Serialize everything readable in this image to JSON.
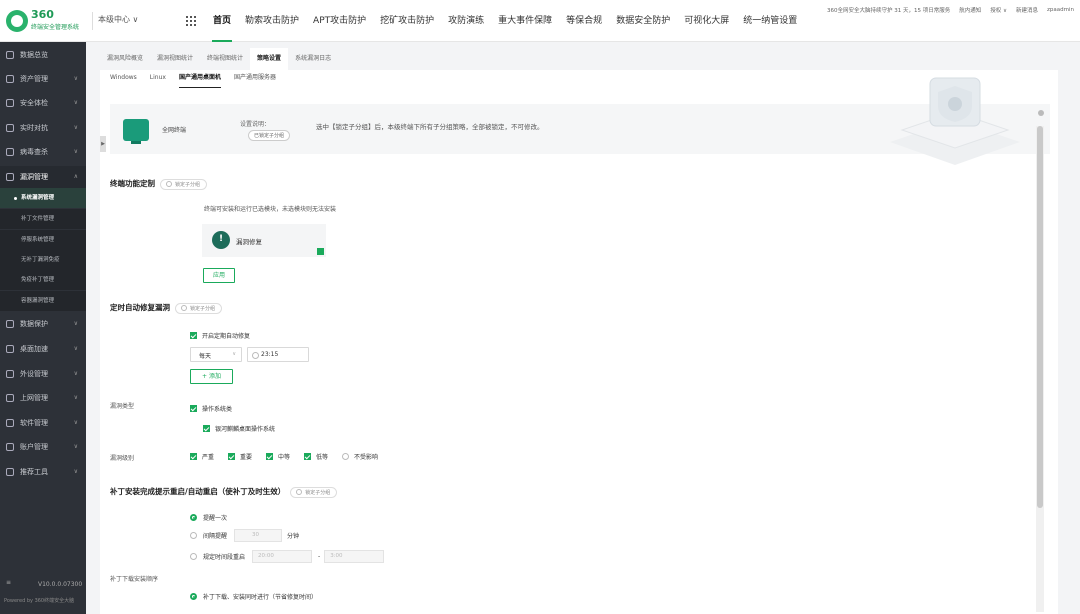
{
  "app": {
    "logo_text": "360",
    "logo_sub": "终端安全管理系统",
    "unit_selector": "本级中心 ∨"
  },
  "nav": {
    "items": [
      "首页",
      "勒索攻击防护",
      "APT攻击防护",
      "挖矿攻击防护",
      "攻防演练",
      "重大事件保障",
      "等保合规",
      "数据安全防护",
      "可视化大屏",
      "统一纳管设置"
    ],
    "active_index": 0
  },
  "top_right": {
    "protect_text": "360全网安全大脑持续守护 31 天，15 项日常服务",
    "links": [
      "航内通知",
      "授权 ∨",
      "新建消息"
    ],
    "user": "zpaadmin"
  },
  "sidebar": {
    "items": [
      "数据总览",
      "资产管理",
      "安全体检",
      "实时对抗",
      "病毒查杀",
      "漏洞管理",
      "数据保护",
      "桌面加速",
      "外设管理",
      "上网管理",
      "软件管理",
      "账户管理",
      "推荐工具"
    ],
    "sub_items": [
      "系统漏洞管理",
      "补丁文件管理",
      "停服系统管理",
      "无补丁漏洞免疫",
      "免疫补丁管理",
      "容器漏洞管理"
    ],
    "active_sub": 0,
    "version": "V10.0.0.07300",
    "powered": "Powered by 360终端安全大脑"
  },
  "tabs_level1": [
    "漏洞风险概览",
    "漏洞视图统计",
    "终端视图统计",
    "策略设置",
    "系统漏洞日志"
  ],
  "tabs_level1_active": 3,
  "tabs_level2": [
    "Windows",
    "Linux",
    "国产通用桌面机",
    "国产通用服务器"
  ],
  "tabs_level2_active": 2,
  "banner": {
    "target": "全网终端",
    "setting_label": "设置说明：",
    "lock_tag": "已锁定子分组",
    "description": "选中【锁定子分组】后，本级终端下所有子分组策略，全部被锁定，不可修改。"
  },
  "lock_label": "锁定子分组",
  "func_section": {
    "title": "终端功能定制",
    "hint": "终端可安装和运行已选模块，未选模块则无法安装",
    "module_name": "漏洞修复",
    "apply_label": "应用"
  },
  "auto_section": {
    "title": "定时自动修复漏洞",
    "enable_label": "开启定期自动修复",
    "freq_value": "每天",
    "time_value": "23:15",
    "add_label": "+ 添加",
    "type_label": "漏洞类型",
    "type_os": "操作系统类",
    "type_os_sub": "银河麒麟桌面操作系统",
    "level_label": "漏洞级别",
    "levels": [
      {
        "label": "严重",
        "checked": true
      },
      {
        "label": "重要",
        "checked": true
      },
      {
        "label": "中等",
        "checked": true
      },
      {
        "label": "低等",
        "checked": true
      },
      {
        "label": "不受影响",
        "checked": false
      }
    ]
  },
  "restart_section": {
    "title": "补丁安装完成提示重启/自动重启（使补丁及时生效）",
    "opt1": "提醒一次",
    "opt2": "间隔提醒",
    "opt2_value": "30",
    "opt2_unit": "分钟",
    "opt3": "规定时间段重启",
    "time_start": "20:00",
    "time_sep": "-",
    "time_end": "3:00"
  },
  "download_section": {
    "title": "补丁下载安装顺序",
    "opt1": "补丁下载、安装同时进行（节省修复时间）"
  }
}
